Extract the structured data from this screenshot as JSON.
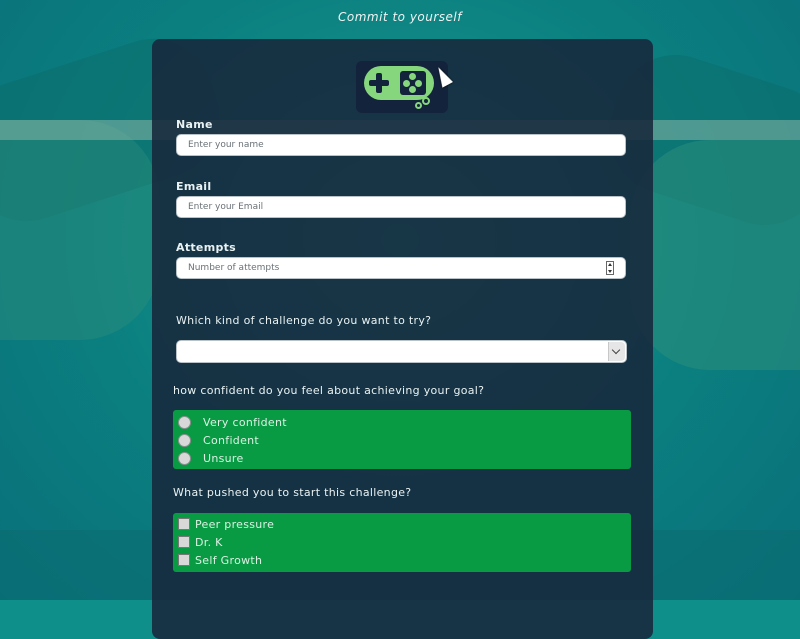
{
  "header": {
    "title": "Commit to yourself"
  },
  "logo": {
    "icon": "gamepad-logo-icon"
  },
  "fields": {
    "name": {
      "label": "Name",
      "placeholder": "Enter your name"
    },
    "email": {
      "label": "Email",
      "placeholder": "Enter your Email"
    },
    "attempts": {
      "label": "Attempts",
      "placeholder": "Number of attempts"
    }
  },
  "challenge": {
    "question": "Which kind of challenge do you want to try?",
    "selected": ""
  },
  "confidence": {
    "question": "how confident do you feel about achieving your goal?",
    "options": [
      "Very confident",
      "Confident",
      "Unsure"
    ]
  },
  "motivation": {
    "question": "What pushed you to start this challenge?",
    "options": [
      "Peer pressure",
      "Dr. K",
      "Self Growth"
    ]
  },
  "colors": {
    "card": "#17253a",
    "accent_green": "#099b44",
    "logo_green": "#86d67d"
  }
}
